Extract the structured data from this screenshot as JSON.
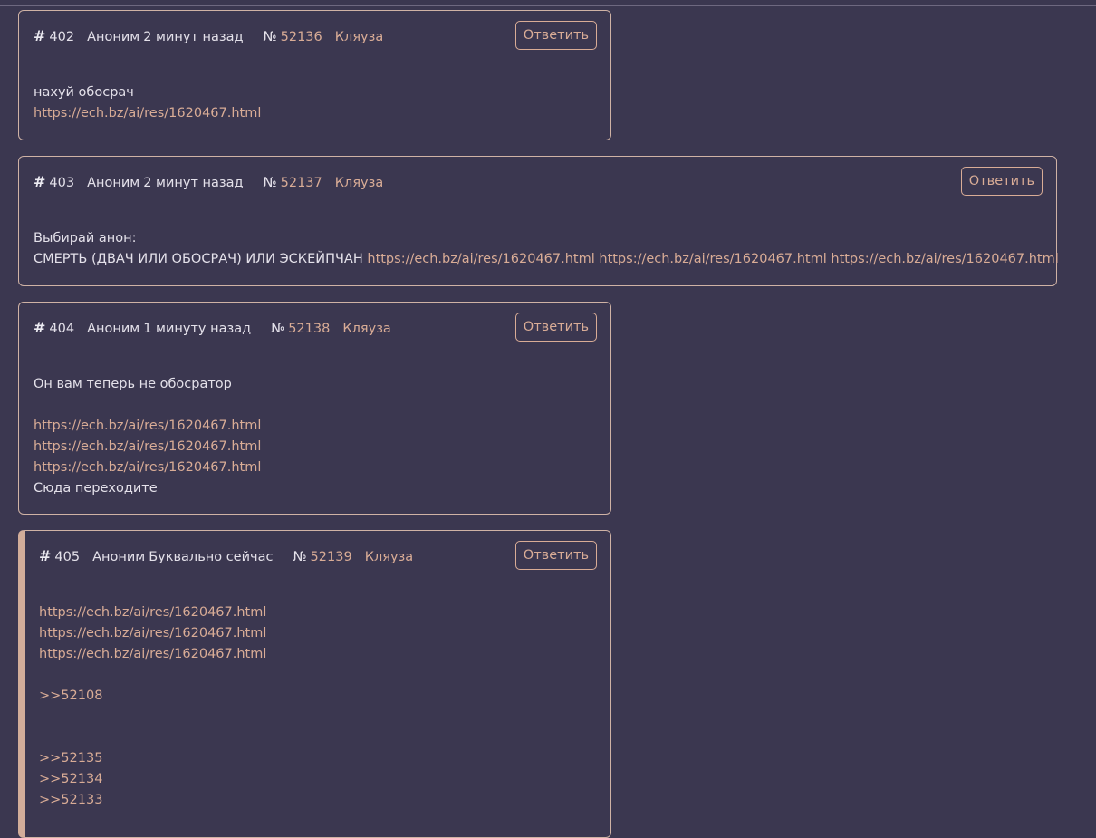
{
  "reply_label": "Ответить",
  "author": "Аноним",
  "no_sign": "№",
  "posts": [
    {
      "num": "402",
      "time": "2 минут назад",
      "post_id": "52136",
      "report": "Кляуза",
      "lines": [
        {
          "text": "нахуй обосрач"
        },
        {
          "link": "https://ech.bz/ai/res/1620467.html"
        }
      ]
    },
    {
      "num": "403",
      "time": "2 минут назад",
      "post_id": "52137",
      "report": "Кляуза",
      "lines": [
        {
          "text": "Выбирай анон:"
        },
        {
          "text": "СМЕРТЬ (ДВАЧ ИЛИ ОБОСРАЧ) ИЛИ ЭСКЕЙПЧАН",
          "links": [
            "https://ech.bz/ai/res/1620467.html",
            "https://ech.bz/ai/res/1620467.html",
            "https://ech.bz/ai/res/1620467.html"
          ]
        }
      ]
    },
    {
      "num": "404",
      "time": "1 минуту назад",
      "post_id": "52138",
      "report": "Кляуза",
      "lines": [
        {
          "text": "Он вам теперь не обосратор"
        },
        {
          "text": ""
        },
        {
          "link": "https://ech.bz/ai/res/1620467.html"
        },
        {
          "link": "https://ech.bz/ai/res/1620467.html"
        },
        {
          "link": "https://ech.bz/ai/res/1620467.html"
        },
        {
          "text": "Сюда переходите"
        }
      ]
    },
    {
      "num": "405",
      "time": "Буквально сейчас",
      "post_id": "52139",
      "report": "Кляуза",
      "lines": [
        {
          "link": "https://ech.bz/ai/res/1620467.html"
        },
        {
          "link": "https://ech.bz/ai/res/1620467.html"
        },
        {
          "link": "https://ech.bz/ai/res/1620467.html"
        },
        {
          "text": ""
        },
        {
          "link": ">>52108"
        },
        {
          "text": ""
        },
        {
          "text": ""
        },
        {
          "link": ">>52135"
        },
        {
          "link": ">>52134"
        },
        {
          "link": ">>52133"
        }
      ]
    }
  ]
}
